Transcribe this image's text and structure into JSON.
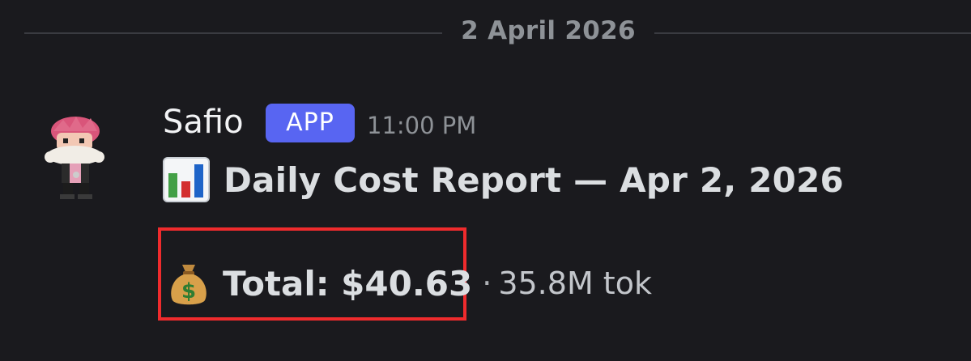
{
  "date_divider": {
    "label": "2 April 2026"
  },
  "message": {
    "author": "Safio",
    "badge": "APP",
    "time": "11:00 PM",
    "title_icon": "bar-chart-emoji",
    "title": "Daily Cost Report — Apr 2, 2026",
    "total_icon": "money-bag-emoji",
    "total": "Total: $40.63",
    "separator": "·",
    "tokens": "35.8M tok"
  },
  "colors": {
    "background": "#1a1a1e",
    "badge": "#5865f2",
    "highlight": "#ef2b2d",
    "muted_text": "#8e9297",
    "text": "#dbdee1"
  }
}
